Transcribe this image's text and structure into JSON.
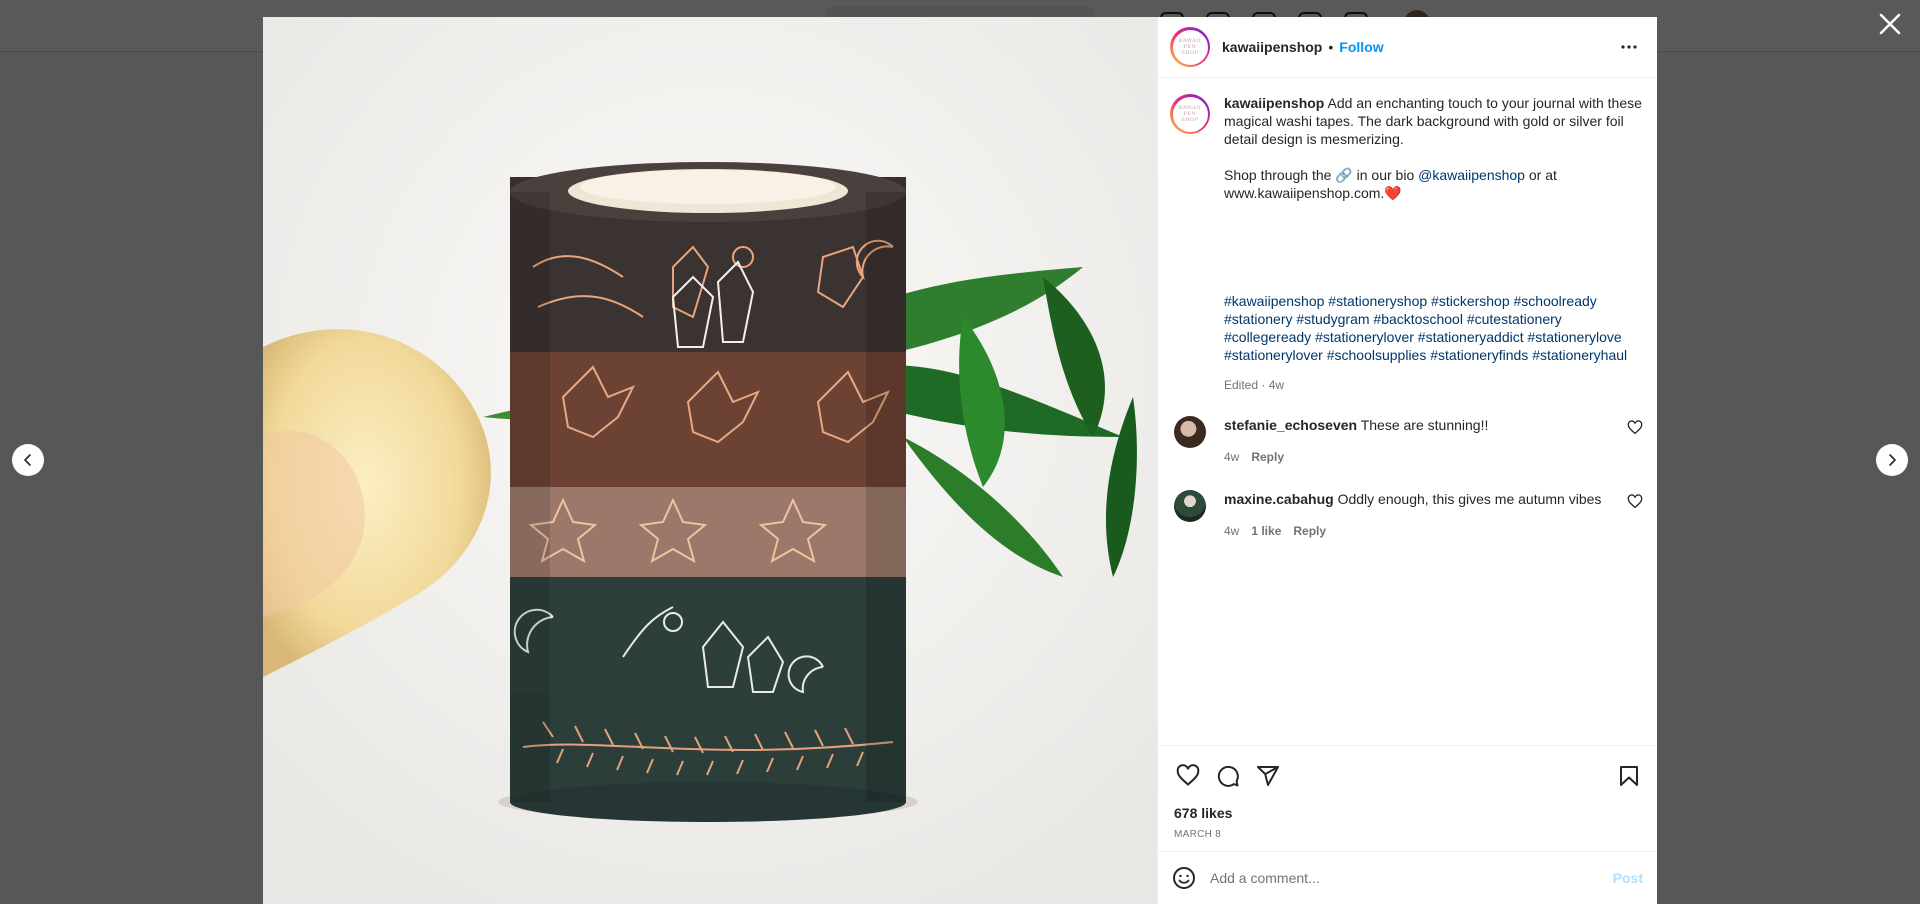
{
  "post": {
    "username": "kawaiipenshop",
    "follow_label": "Follow",
    "dot": "•",
    "avatar_text": "KAWAII PEN SHOP",
    "caption": {
      "username": "kawaiipenshop",
      "text1": "Add an enchanting touch to your journal with these magical washi tapes. The dark background with gold or silver foil detail design is mesmerizing.",
      "text2_before": "Shop through the 🔗 in our bio",
      "mention": "@kawaiipenshop",
      "text2_after": "or at www.kawaiipenshop.com.❤️",
      "hashtags": [
        "#kawaiipenshop",
        "#stationeryshop",
        "#stickershop",
        "#schoolready",
        "#stationery",
        "#studygram",
        "#backtoschool",
        "#cutestationery",
        "#collegeready",
        "#stationerylover",
        "#stationeryaddict",
        "#stationerylove",
        "#stationerylover",
        "#schoolsupplies",
        "#stationeryfinds",
        "#stationeryhaul"
      ],
      "meta": "Edited · 4w"
    },
    "comments": [
      {
        "username": "stefanie_echoseven",
        "text": "These are stunning!!",
        "time": "4w",
        "likes": "",
        "reply_label": "Reply"
      },
      {
        "username": "maxine.cabahug",
        "text": "Oddly enough, this gives me autumn vibes",
        "time": "4w",
        "likes": "1 like",
        "reply_label": "Reply"
      }
    ],
    "likes": "678 likes",
    "date": "MARCH 8",
    "add_comment_placeholder": "Add a comment...",
    "post_label": "Post"
  },
  "icons": {
    "close": "close-icon",
    "prev": "chevron-left-icon",
    "next": "chevron-right-icon",
    "more": "more-horizontal-icon",
    "like": "heart-icon",
    "comment": "comment-icon",
    "share": "share-icon",
    "save": "bookmark-icon",
    "emoji": "emoji-icon"
  }
}
